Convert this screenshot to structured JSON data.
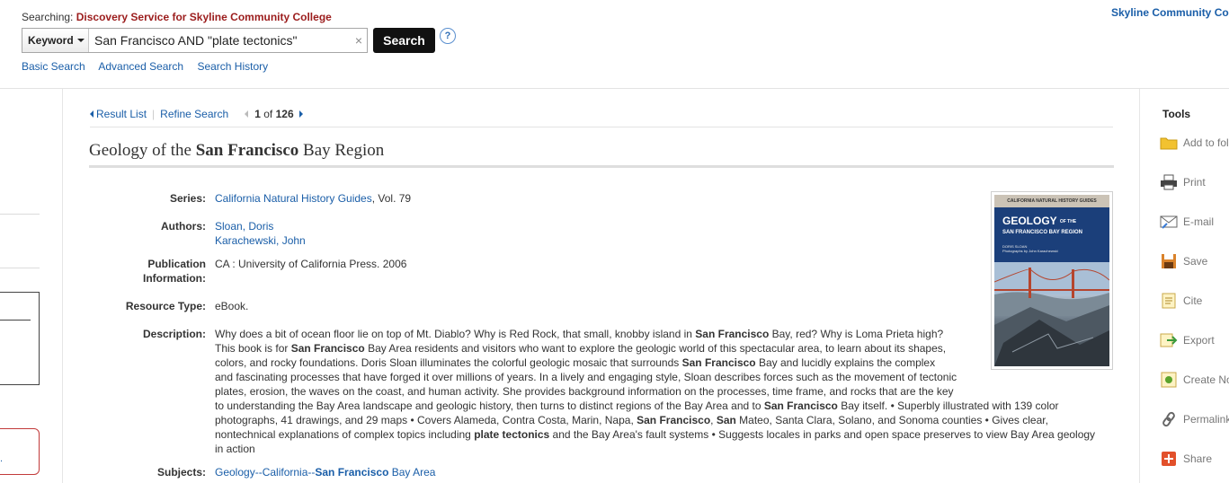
{
  "header": {
    "searching_prefix": "Searching:",
    "service_name": "Discovery Service for Skyline Community College",
    "field_label": "Keyword",
    "query": "San Francisco AND \"plate tectonics\"",
    "clear_glyph": "×",
    "search_button": "Search",
    "help_glyph": "?",
    "links": [
      "Basic Search",
      "Advanced Search",
      "Search History"
    ],
    "institution": "Skyline Community Co"
  },
  "nav": {
    "result_list": "Result List",
    "refine_search": "Refine Search",
    "position_current": "1",
    "position_of": "of",
    "position_total": "126"
  },
  "record": {
    "title_pre": "Geology of the ",
    "title_bold": "San Francisco",
    "title_post": " Bay Region",
    "fields": {
      "series_label": "Series:",
      "series_link": "California Natural History Guides",
      "series_rest": ", Vol. 79",
      "authors_label": "Authors:",
      "authors": [
        "Sloan, Doris",
        "Karachewski, John"
      ],
      "pubinfo_label_1": "Publication",
      "pubinfo_label_2": "Information:",
      "pubinfo": "CA : University of California Press. 2006",
      "restype_label": "Resource Type:",
      "restype": "eBook.",
      "desc_label": "Description:",
      "subjects_label": "Subjects:",
      "subjects_pre": "Geology--California--",
      "subjects_bold": "San Francisco",
      "subjects_post": " Bay Area"
    },
    "description_lines": [
      [
        "Why does a bit of ocean floor lie on top of Mt. Diablo? Why is Red Rock, that small, knobby island in ",
        "San Francisco",
        " Bay, red? Why is Loma Prieta high?"
      ],
      [
        "This book is for ",
        "San Francisco",
        " Bay Area residents and visitors who want to explore the geologic world of this spectacular area, to learn about its shapes,"
      ],
      [
        "colors, and rocky foundations. Doris Sloan illuminates the colorful geologic mosaic that surrounds ",
        "San Francisco",
        " Bay and lucidly explains the complex"
      ],
      [
        "and fascinating processes that have forged it over millions of years. In a lively and engaging style, Sloan describes forces such as the movement of tectonic",
        "",
        ""
      ],
      [
        "plates, erosion, the waves on the coast, and human activity. She provides background information on the processes, time frame, and rocks that are the key",
        "",
        ""
      ],
      [
        "to understanding the Bay Area landscape and geologic history, then turns to distinct regions of the Bay Area and to ",
        "San Francisco",
        " Bay itself. • Superbly illustrated with 139 color"
      ],
      [
        "photographs, 41 drawings, and 29 maps • Covers Alameda, Contra Costa, Marin, Napa, ",
        "San Francisco",
        ", "
      ],
      [
        "nontechnical explanations of complex topics including ",
        "plate tectonics",
        " and the Bay Area's fault systems • Suggests locales in parks and open space preserves to view Bay Area geology"
      ],
      [
        "in action",
        "",
        ""
      ]
    ],
    "desc_line7_extra_bold": "San",
    "desc_line7_tail": " Mateo, Santa Clara, Solano, and Sonoma counties • Gives clear,",
    "cover": {
      "band": "CALIFORNIA NATURAL HISTORY GUIDES",
      "title_big": "GEOLOGY",
      "title_small": "OF THE",
      "subtitle": "SAN FRANCISCO BAY REGION",
      "author": "DORIS SLOAN",
      "credit": "Photographs by John Karachewski"
    }
  },
  "tools": {
    "title": "Tools",
    "items": [
      {
        "label": "Add to fol",
        "icon": "folder-icon"
      },
      {
        "label": "Print",
        "icon": "printer-icon"
      },
      {
        "label": "E-mail",
        "icon": "email-icon"
      },
      {
        "label": "Save",
        "icon": "save-disk-icon"
      },
      {
        "label": "Cite",
        "icon": "cite-document-icon"
      },
      {
        "label": "Export",
        "icon": "export-icon"
      },
      {
        "label": "Create No",
        "icon": "note-icon"
      },
      {
        "label": "Permalink",
        "icon": "link-chain-icon"
      },
      {
        "label": "Share",
        "icon": "share-plus-icon"
      }
    ]
  },
  "left_panel": {
    "fragment_text": "."
  },
  "colors": {
    "link": "#1a5ea8",
    "service": "#9b1c1c",
    "button": "#111111"
  }
}
